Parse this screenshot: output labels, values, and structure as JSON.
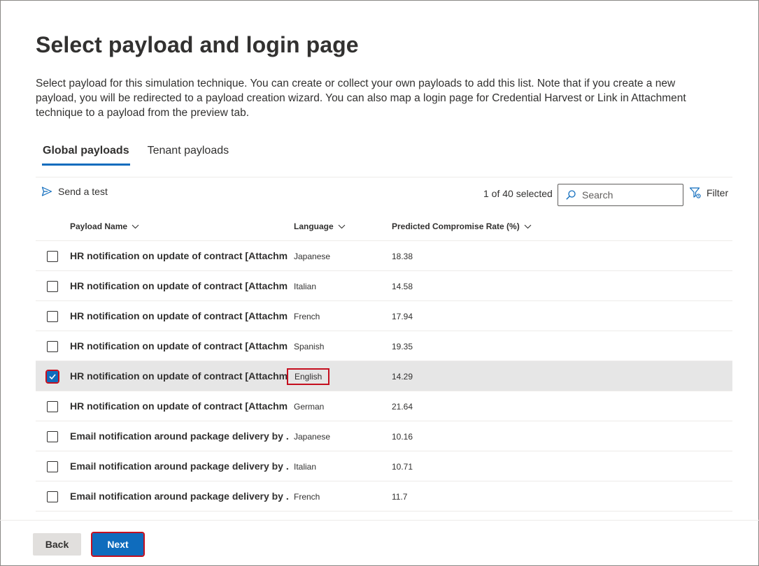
{
  "page": {
    "title": "Select payload and login page",
    "description": "Select payload for this simulation technique. You can create or collect your own payloads to add this list. Note that if you create a new payload, you will be redirected to a payload creation wizard. You can also map a login page for Credential Harvest or Link in Attachment technique to a payload from the preview tab."
  },
  "tabs": [
    {
      "label": "Global payloads",
      "active": true
    },
    {
      "label": "Tenant payloads",
      "active": false
    }
  ],
  "toolbar": {
    "send_test_label": "Send a test",
    "send_icon": "send-icon",
    "selection_count": "1 of 40 selected",
    "search_placeholder": "Search",
    "search_icon": "search-icon",
    "filter_label": "Filter",
    "filter_icon": "filter-icon"
  },
  "table": {
    "columns": [
      {
        "label": "Payload Name"
      },
      {
        "label": "Language"
      },
      {
        "label": "Predicted Compromise Rate (%)"
      }
    ],
    "rows": [
      {
        "name": "HR notification on update of contract [Attachm...",
        "language": "Japanese",
        "rate": "18.38",
        "selected": false
      },
      {
        "name": "HR notification on update of contract [Attachm...",
        "language": "Italian",
        "rate": "14.58",
        "selected": false
      },
      {
        "name": "HR notification on update of contract [Attachm...",
        "language": "French",
        "rate": "17.94",
        "selected": false
      },
      {
        "name": "HR notification on update of contract [Attachm...",
        "language": "Spanish",
        "rate": "19.35",
        "selected": false
      },
      {
        "name": "HR notification on update of contract [Attachm...",
        "language": "English",
        "rate": "14.29",
        "selected": true
      },
      {
        "name": "HR notification on update of contract [Attachm...",
        "language": "German",
        "rate": "21.64",
        "selected": false
      },
      {
        "name": "Email notification around package delivery by ...",
        "language": "Japanese",
        "rate": "10.16",
        "selected": false
      },
      {
        "name": "Email notification around package delivery by ...",
        "language": "Italian",
        "rate": "10.71",
        "selected": false
      },
      {
        "name": "Email notification around package delivery by ...",
        "language": "French",
        "rate": "11.7",
        "selected": false
      }
    ]
  },
  "footer": {
    "back_label": "Back",
    "next_label": "Next"
  },
  "colors": {
    "accent": "#0f6cbd",
    "highlight": "#c50f1f",
    "selected_row": "#e6e6e6"
  }
}
